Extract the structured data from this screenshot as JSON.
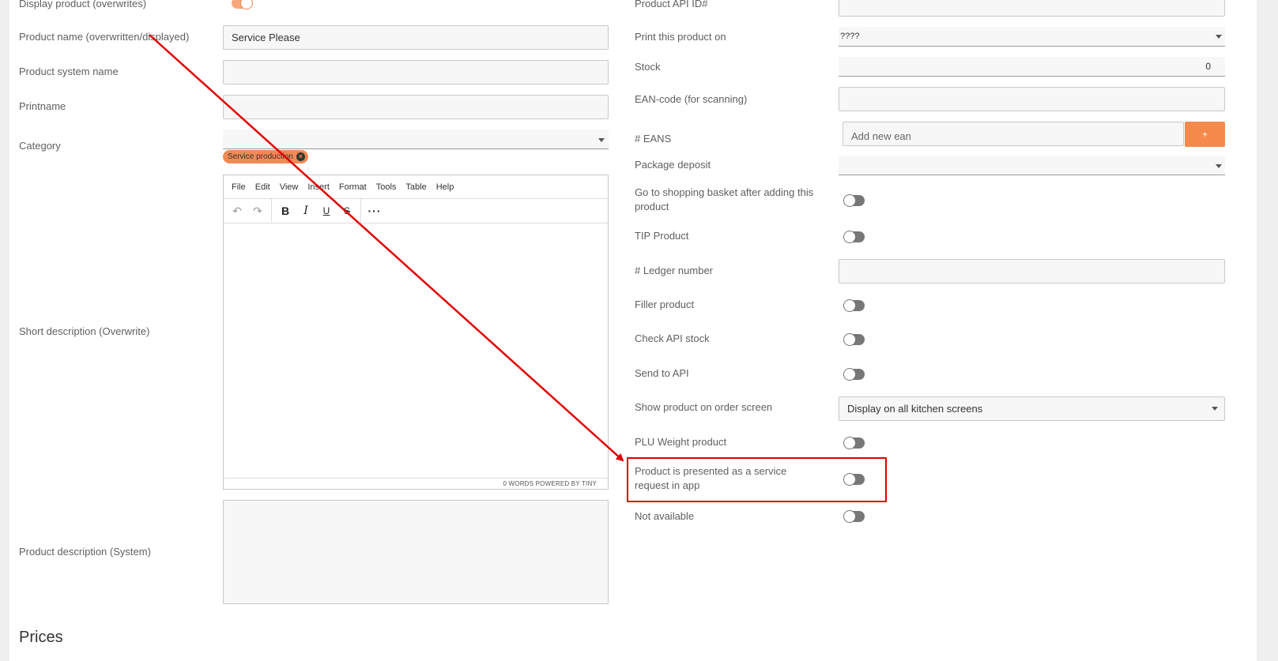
{
  "left": {
    "display_product_label": "Display product (overwrites)",
    "product_name_label": "Product name (overwritten/displayed)",
    "product_name_value": "Service Please",
    "system_name_label": "Product system name",
    "printname_label": "Printname",
    "category_label": "Category",
    "category_chip": "Service production",
    "short_desc_label": "Short description (Overwrite)",
    "product_desc_label": "Product description (System)",
    "editor": {
      "menus": [
        "File",
        "Edit",
        "View",
        "Insert",
        "Format",
        "Tools",
        "Table",
        "Help"
      ],
      "status": "0 WORDS  POWERED BY TINY"
    }
  },
  "right": {
    "api_id_label": "Product API ID#",
    "print_on_label": "Print this product on",
    "print_on_value": "????",
    "stock_label": "Stock",
    "stock_value": "0",
    "ean_label": "EAN-code (for scanning)",
    "eans_label": "# EANS",
    "eans_placeholder": "Add new ean",
    "eans_add": "+",
    "deposit_label": "Package deposit",
    "basket_label": "Go to shopping basket after adding this product",
    "tip_label": "TIP Product",
    "ledger_label": "# Ledger number",
    "filler_label": "Filler product",
    "check_api_label": "Check API stock",
    "send_api_label": "Send to API",
    "order_screen_label": "Show product on order screen",
    "order_screen_value": "Display on all kitchen screens",
    "plu_label": "PLU Weight product",
    "service_request_label": "Product is presented as a service request in app",
    "not_available_label": "Not available"
  },
  "prices_heading": "Prices",
  "colors": {
    "accent": "#f58a4c",
    "annotation": "#e00000"
  }
}
